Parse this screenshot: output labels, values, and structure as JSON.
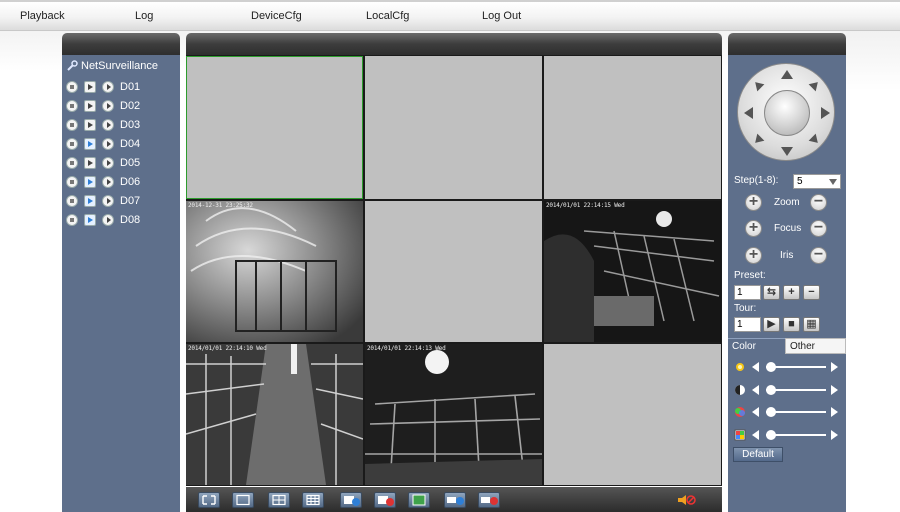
{
  "menu": {
    "items": [
      "Playback",
      "Log",
      "DeviceCfg",
      "LocalCfg",
      "Log Out"
    ]
  },
  "device_tree": {
    "root_label": "NetSurveillance",
    "devices": [
      "D01",
      "D02",
      "D03",
      "D04",
      "D05",
      "D06",
      "D07",
      "D08"
    ]
  },
  "video": {
    "cells": [
      {
        "id": "cell-1",
        "state": "empty"
      },
      {
        "id": "cell-2",
        "state": "empty"
      },
      {
        "id": "cell-3",
        "state": "empty"
      },
      {
        "id": "cell-4",
        "state": "feed",
        "osd_top": "2014-12-31 23:25:32",
        "osd_bottom": ""
      },
      {
        "id": "cell-5",
        "state": "empty"
      },
      {
        "id": "cell-6",
        "state": "feed",
        "osd_top": "2014/01/01 22:14:15 Wed",
        "osd_bottom": ""
      },
      {
        "id": "cell-7",
        "state": "feed",
        "osd_top": "2014/01/01 22:14:10 Wed",
        "osd_bottom": ""
      },
      {
        "id": "cell-8",
        "state": "feed",
        "osd_top": "2014/01/01 22:14:13 Wed",
        "osd_bottom": ""
      },
      {
        "id": "cell-9",
        "state": "empty"
      }
    ]
  },
  "ptz": {
    "step_label": "Step(1-8):",
    "step_value": "5",
    "zoom_label": "Zoom",
    "focus_label": "Focus",
    "iris_label": "Iris",
    "preset_label": "Preset:",
    "preset_value": "1",
    "tour_label": "Tour:",
    "tour_value": "1"
  },
  "color_tabs": {
    "color_label": "Color",
    "other_label": "Other"
  },
  "default_label": "Default",
  "colors": {
    "panel_bg": "#5e6f8b",
    "empty_cell": "#c0c0c0",
    "active_border": "#2d9c2d"
  }
}
